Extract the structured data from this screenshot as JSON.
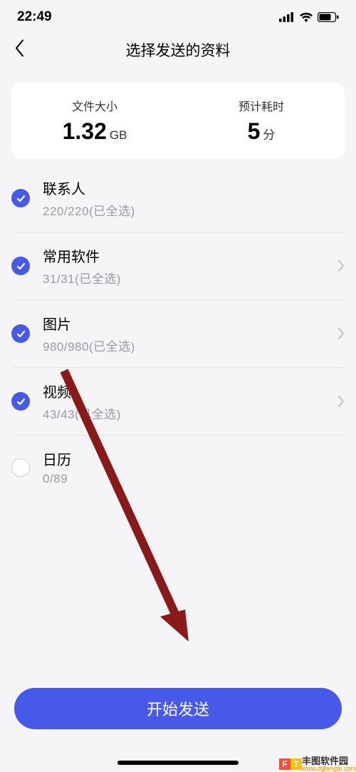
{
  "status": {
    "time": "22:49"
  },
  "header": {
    "title": "选择发送的资料"
  },
  "summary": {
    "size_label": "文件大小",
    "size_value": "1.32",
    "size_unit": "GB",
    "time_label": "预计耗时",
    "time_value": "5",
    "time_unit": "分"
  },
  "items": [
    {
      "title": "联系人",
      "sub": "220/220(已全选)",
      "checked": true,
      "chevron": false
    },
    {
      "title": "常用软件",
      "sub": "31/31(已全选)",
      "checked": true,
      "chevron": true
    },
    {
      "title": "图片",
      "sub": "980/980(已全选)",
      "checked": true,
      "chevron": true
    },
    {
      "title": "视频",
      "sub": "43/43(已全选)",
      "checked": true,
      "chevron": true
    },
    {
      "title": "日历",
      "sub": "0/89",
      "checked": false,
      "chevron": false
    }
  ],
  "action": {
    "send": "开始发送"
  },
  "watermark": {
    "brand": "丰图软件园",
    "url": "www.dgfengtu.com"
  }
}
